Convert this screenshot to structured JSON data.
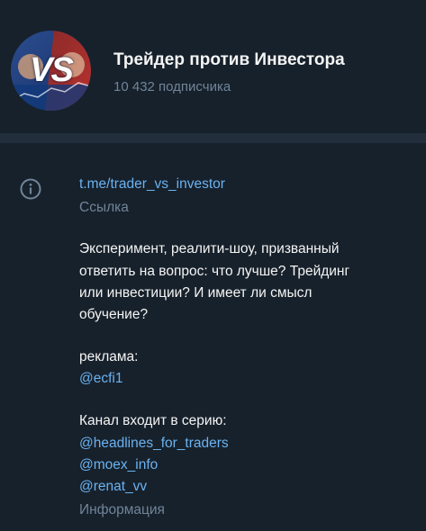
{
  "channel": {
    "title": "Трейдер против Инвестора",
    "subscribers": "10 432 подписчика",
    "avatar_text": "VS"
  },
  "info": {
    "link": "t.me/trader_vs_investor",
    "link_caption": "Ссылка",
    "description_lines": [
      "Эксперимент, реалити-шоу, призванный",
      "ответить на вопрос: что лучше? Трейдинг",
      "или инвестиции? И имеет ли смысл",
      "обучение?"
    ],
    "ads_label": "реклама:",
    "ads_contact": "@ecfi1",
    "series_label": "Канал входит в серию:",
    "series_links": [
      "@headlines_for_traders",
      "@moex_info",
      "@renat_vv"
    ],
    "info_caption": "Информация"
  },
  "colors": {
    "background": "#17212b",
    "divider": "#232e3c",
    "link": "#6ab2f2",
    "muted": "#708499",
    "text": "#f5f5f5"
  },
  "icons": {
    "info": "info-circle-icon"
  }
}
